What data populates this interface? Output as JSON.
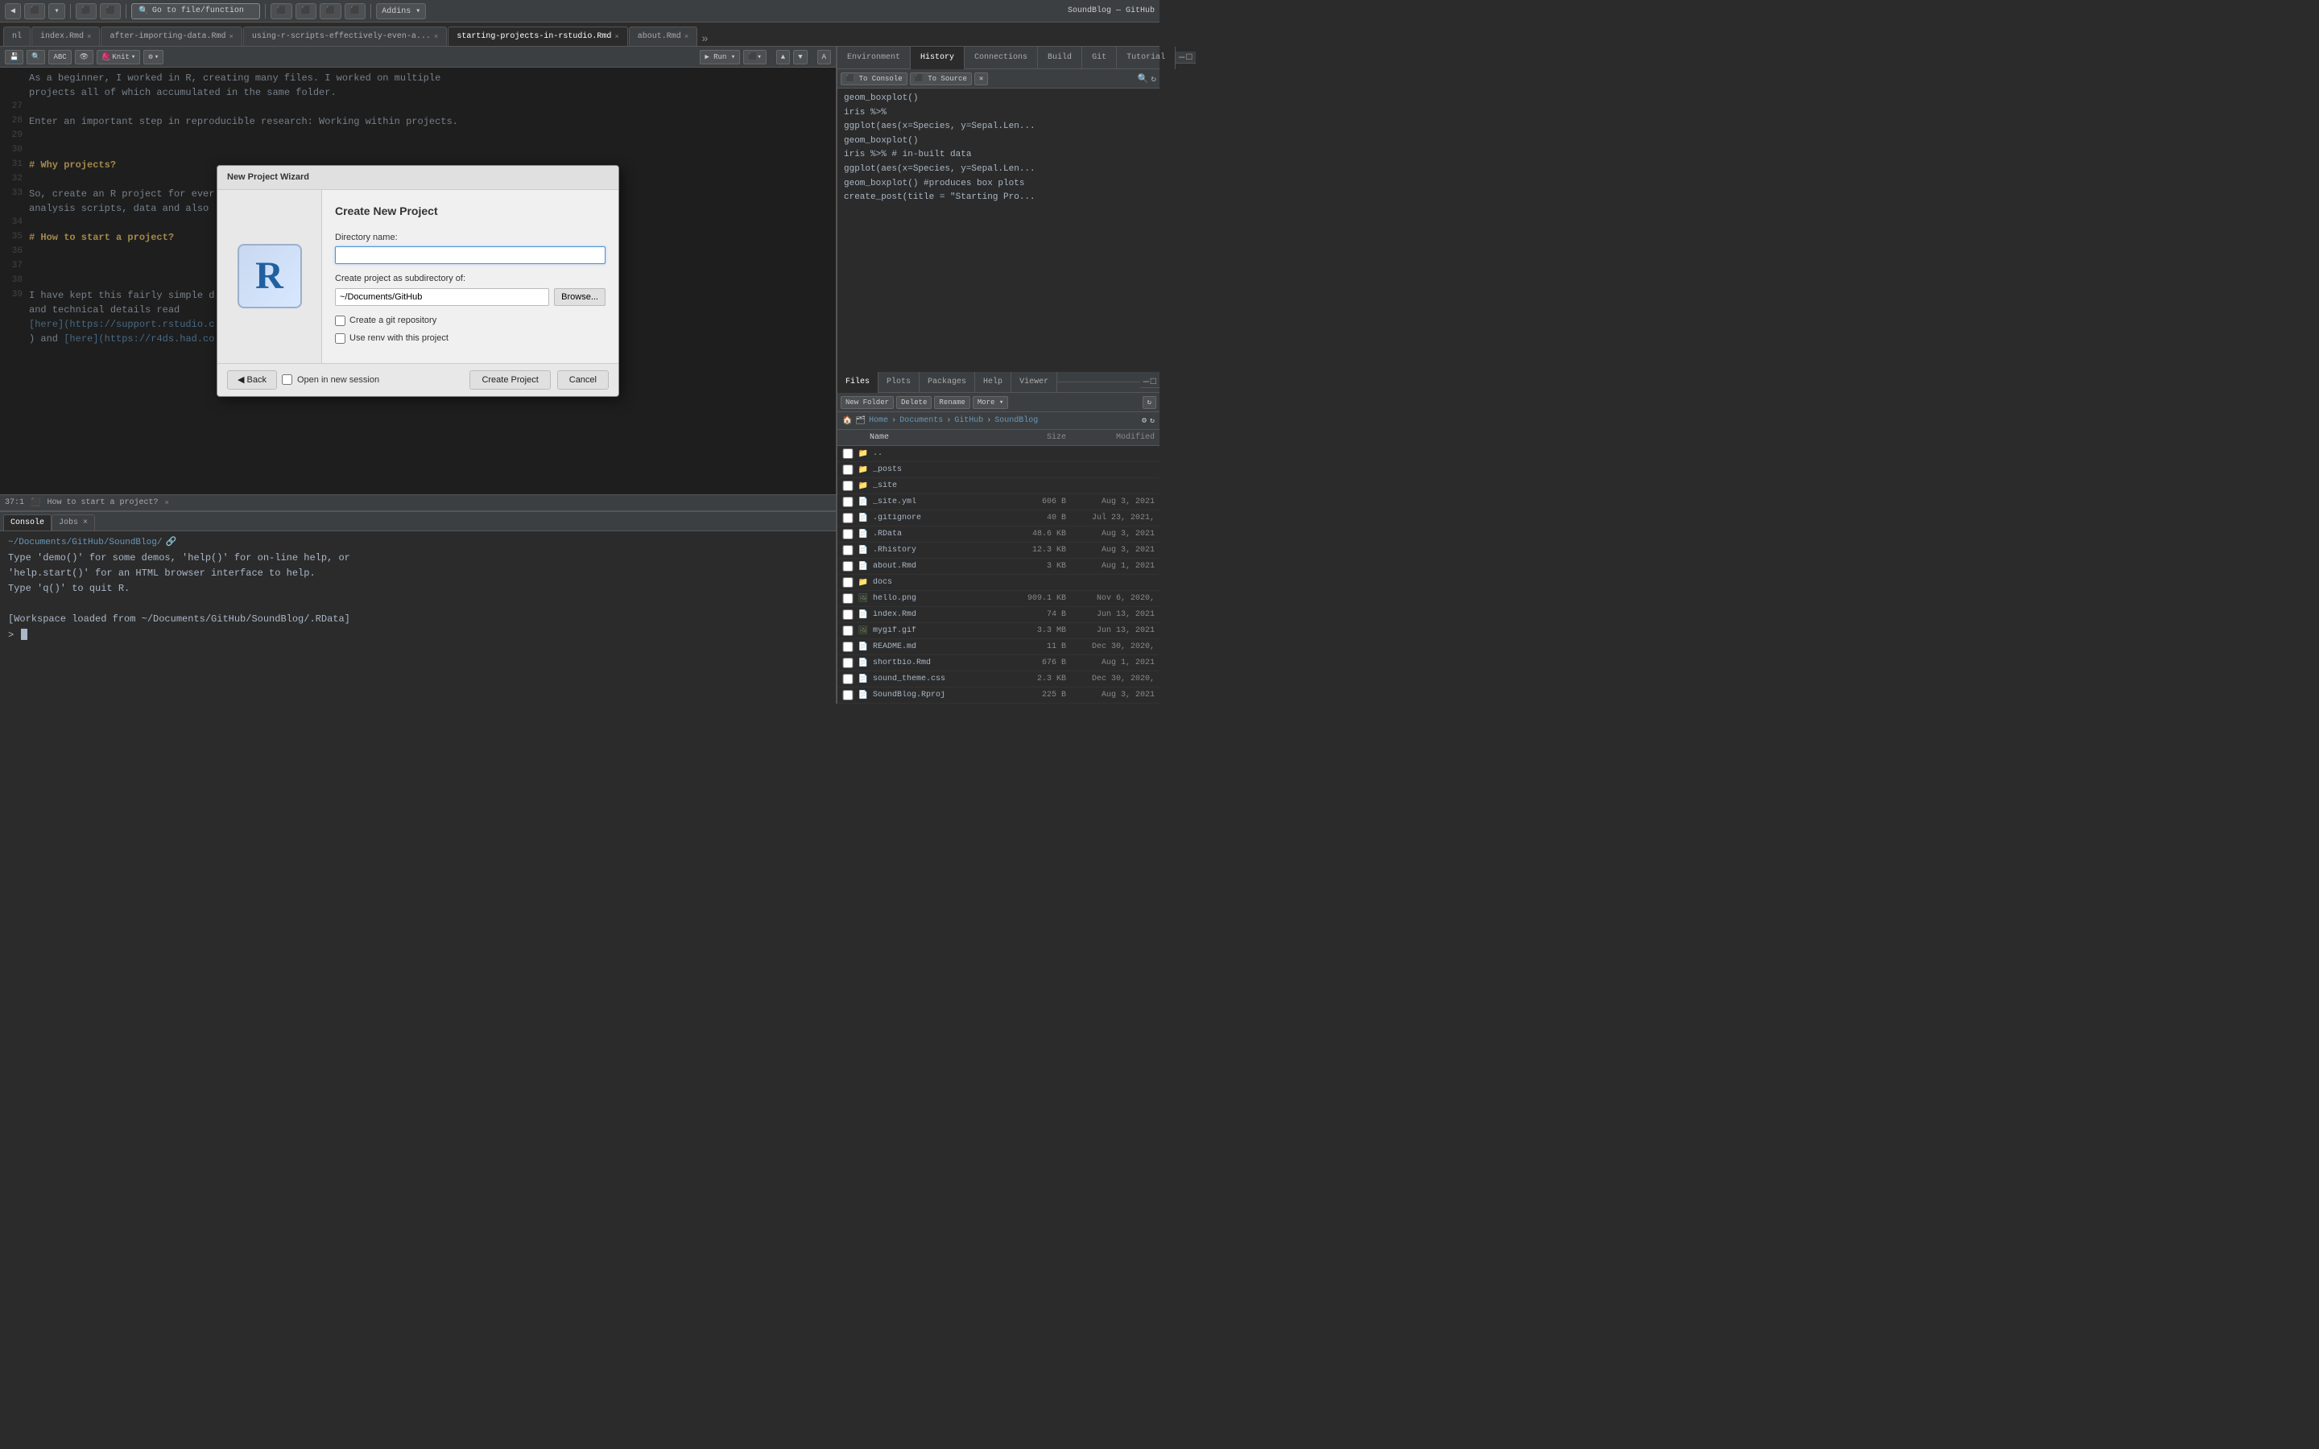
{
  "app": {
    "title": "SoundBlog — GitHub",
    "top_title": "SoundBlog — GitHub"
  },
  "top_toolbar": {
    "buttons": [
      "◀",
      "⬛",
      "▾",
      "◀",
      "▾",
      "⬛",
      "▾",
      "⬛",
      "▾"
    ],
    "go_to_file": "Go to file/function",
    "addins_label": "Addins ▾"
  },
  "tabs": [
    {
      "label": "nl",
      "closeable": false
    },
    {
      "label": "index.Rmd",
      "closeable": true,
      "active": false
    },
    {
      "label": "after-importing-data.Rmd",
      "closeable": true,
      "active": false
    },
    {
      "label": "using-r-scripts-effectively-even-a...",
      "closeable": true,
      "active": false
    },
    {
      "label": "starting-projects-in-rstudio.Rmd",
      "closeable": true,
      "active": true
    },
    {
      "label": "about.Rmd",
      "closeable": true,
      "active": false
    },
    {
      "label": "▾",
      "closeable": false
    }
  ],
  "editor_toolbar": {
    "knit_label": "Knit",
    "settings_icon": "⚙"
  },
  "code_lines": [
    {
      "num": "27",
      "content": ""
    },
    {
      "num": "28",
      "content": "Enter an important step in reproducible research: Working within projects.",
      "style": "normal"
    },
    {
      "num": "29",
      "content": ""
    },
    {
      "num": "30",
      "content": ""
    },
    {
      "num": "31",
      "content": "# Why projects?",
      "style": "heading"
    },
    {
      "num": "32",
      "content": ""
    },
    {
      "num": "33",
      "content": "So, create an R project for ever...",
      "style": "normal"
    },
    {
      "num": "",
      "content": "analysis scripts, data and also",
      "style": "normal"
    },
    {
      "num": "34",
      "content": ""
    },
    {
      "num": "35",
      "content": "# How to start a project?",
      "style": "heading"
    },
    {
      "num": "36",
      "content": ""
    },
    {
      "num": "37",
      "content": ""
    },
    {
      "num": "38",
      "content": ""
    },
    {
      "num": "39",
      "content": "I have kept this fairly simple d...",
      "style": "normal"
    },
    {
      "num": "",
      "content": "and technical details read",
      "style": "normal"
    },
    {
      "num": "",
      "content": "[here](https://support.rstudio.c...",
      "style": "link"
    },
    {
      "num": "",
      "content": ") and [here](https://r4ds.had.co...",
      "style": "link"
    }
  ],
  "status_bar": {
    "position": "37:1",
    "label": "How to start a project?",
    "close": "×"
  },
  "console": {
    "path": "~/Documents/GitHub/SoundBlog/",
    "lines": [
      "Type 'demo()' for some demos, 'help()' for on-line help, or",
      "'help.start()' for an HTML browser interface to help.",
      "Type 'q()' to quit R.",
      "",
      "[Workspace loaded from ~/Documents/GitHub/SoundBlog/.RData]"
    ],
    "prompt": ">"
  },
  "right_tabs": {
    "tabs": [
      "Environment",
      "History",
      "Connections",
      "Build",
      "Git",
      "Tutorial"
    ]
  },
  "history_panel": {
    "items": [
      "geom_boxplot()",
      "iris %>%",
      "ggplot(aes(x=Species, y=Sepal.Len...",
      "geom_boxplot()",
      "iris %>% # in-built data",
      "ggplot(aes(x=Species, y=Sepal.Len...",
      "geom_boxplot() #produces box plots",
      "create_post(title = \"Starting Pro..."
    ]
  },
  "files_panel": {
    "tabs": [
      "Files",
      "Plots",
      "Packages",
      "Help",
      "Viewer"
    ],
    "toolbar_buttons": [
      "New Folder",
      "Delete",
      "Rename",
      "More ▾"
    ],
    "path": [
      "Home",
      "Documents",
      "GitHub",
      "SoundBlog"
    ],
    "headers": [
      "Name",
      "Size",
      "Modified"
    ],
    "files": [
      {
        "name": "..",
        "icon": "folder",
        "size": "",
        "modified": ""
      },
      {
        "name": "_posts",
        "icon": "folder",
        "size": "",
        "modified": ""
      },
      {
        "name": "_site",
        "icon": "folder",
        "size": "",
        "modified": ""
      },
      {
        "name": "_site.yml",
        "icon": "yml",
        "size": "606 B",
        "modified": "Aug 3, 2021"
      },
      {
        "name": ".gitignore",
        "icon": "git",
        "size": "40 B",
        "modified": "Jul 23, 2021,"
      },
      {
        "name": ".RData",
        "icon": "rdata",
        "size": "48.6 KB",
        "modified": "Aug 3, 2021"
      },
      {
        "name": ".Rhistory",
        "icon": "rdata",
        "size": "12.3 KB",
        "modified": "Aug 3, 2021"
      },
      {
        "name": "about.Rmd",
        "icon": "rmd",
        "size": "3 KB",
        "modified": "Aug 1, 2021"
      },
      {
        "name": "docs",
        "icon": "folder",
        "size": "",
        "modified": ""
      },
      {
        "name": "hello.png",
        "icon": "png",
        "size": "909.1 KB",
        "modified": "Nov 6, 2020,"
      },
      {
        "name": "index.Rmd",
        "icon": "rmd",
        "size": "74 B",
        "modified": "Jun 13, 2021"
      },
      {
        "name": "mygif.gif",
        "icon": "gif",
        "size": "3.3 MB",
        "modified": "Jun 13, 2021"
      },
      {
        "name": "README.md",
        "icon": "md",
        "size": "11 B",
        "modified": "Dec 30, 2020,"
      },
      {
        "name": "shortbio.Rmd",
        "icon": "rmd",
        "size": "676 B",
        "modified": "Aug 1, 2021"
      },
      {
        "name": "sound_theme.css",
        "icon": "css",
        "size": "2.3 KB",
        "modified": "Dec 30, 2020,"
      },
      {
        "name": "SoundBlog.Rproj",
        "icon": "rproj",
        "size": "225 B",
        "modified": "Aug 3, 2021"
      }
    ]
  },
  "dialog": {
    "title": "New Project Wizard",
    "r_logo": "R",
    "section_title": "Create New Project",
    "dir_label": "Directory name:",
    "dir_placeholder": "",
    "subdir_label": "Create project as subdirectory of:",
    "subdir_value": "~/Documents/GitHub",
    "browse_label": "Browse...",
    "git_label": "Create a git repository",
    "renv_label": "Use renv with this project",
    "open_new_session": "Open in new session",
    "back_label": "◀ Back",
    "create_label": "Create Project",
    "cancel_label": "Cancel"
  }
}
